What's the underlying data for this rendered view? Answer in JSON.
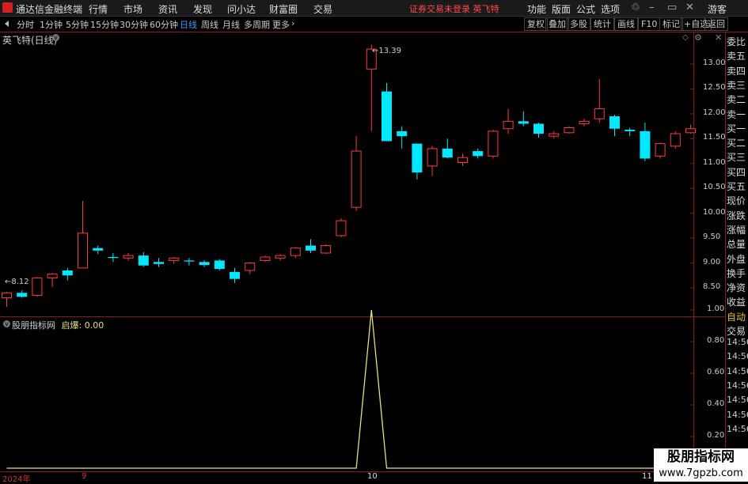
{
  "titlebar": {
    "app_name": "通达信金融终端",
    "menus": [
      "行情",
      "市场",
      "资讯",
      "发现",
      "问小达",
      "财富圈",
      "交易"
    ],
    "notice": "证券交易未登录  英飞特",
    "right_menus": [
      "功能",
      "版面",
      "公式",
      "选项"
    ],
    "guest": "游客"
  },
  "toolbar": {
    "periods": [
      "分时",
      "1分钟",
      "5分钟",
      "15分钟",
      "30分钟",
      "60分钟",
      "日线",
      "周线",
      "月线",
      "多周期",
      "更多"
    ],
    "active_period": "日线",
    "buttons": [
      "复权",
      "叠加",
      "多股",
      "统计",
      "画线",
      "F10",
      "标记",
      "+自选",
      "返回"
    ]
  },
  "main_chart": {
    "title": "英飞特(日线)",
    "max_label": "13.39",
    "min_label": "8.12",
    "y_ticks": [
      "13.00",
      "12.50",
      "12.00",
      "11.50",
      "11.00",
      "10.50",
      "10.00",
      "9.50",
      "9.00",
      "8.50"
    ],
    "candles": [
      {
        "o": 8.3,
        "c": 8.4,
        "h": 8.42,
        "l": 8.12
      },
      {
        "o": 8.4,
        "c": 8.32,
        "h": 8.45,
        "l": 8.3
      },
      {
        "o": 8.35,
        "c": 8.7,
        "h": 8.72,
        "l": 8.32
      },
      {
        "o": 8.7,
        "c": 8.78,
        "h": 8.8,
        "l": 8.52
      },
      {
        "o": 8.85,
        "c": 8.75,
        "h": 8.9,
        "l": 8.65
      },
      {
        "o": 8.9,
        "c": 9.6,
        "h": 10.25,
        "l": 8.9
      },
      {
        "o": 9.3,
        "c": 9.25,
        "h": 9.35,
        "l": 9.18
      },
      {
        "o": 9.12,
        "c": 9.1,
        "h": 9.2,
        "l": 9.02
      },
      {
        "o": 9.1,
        "c": 9.15,
        "h": 9.2,
        "l": 9.05
      },
      {
        "o": 9.15,
        "c": 8.95,
        "h": 9.22,
        "l": 8.92
      },
      {
        "o": 9.02,
        "c": 8.98,
        "h": 9.1,
        "l": 8.92
      },
      {
        "o": 9.05,
        "c": 9.1,
        "h": 9.12,
        "l": 8.98
      },
      {
        "o": 9.05,
        "c": 9.03,
        "h": 9.1,
        "l": 8.95
      },
      {
        "o": 9.02,
        "c": 8.96,
        "h": 9.06,
        "l": 8.92
      },
      {
        "o": 9.05,
        "c": 8.88,
        "h": 9.08,
        "l": 8.85
      },
      {
        "o": 8.82,
        "c": 8.68,
        "h": 8.9,
        "l": 8.6
      },
      {
        "o": 8.85,
        "c": 9.0,
        "h": 9.02,
        "l": 8.78
      },
      {
        "o": 9.05,
        "c": 9.12,
        "h": 9.15,
        "l": 9.02
      },
      {
        "o": 9.1,
        "c": 9.15,
        "h": 9.18,
        "l": 9.05
      },
      {
        "o": 9.15,
        "c": 9.3,
        "h": 9.32,
        "l": 9.1
      },
      {
        "o": 9.35,
        "c": 9.25,
        "h": 9.48,
        "l": 9.2
      },
      {
        "o": 9.2,
        "c": 9.35,
        "h": 9.38,
        "l": 9.18
      },
      {
        "o": 9.55,
        "c": 9.85,
        "h": 9.9,
        "l": 9.52
      },
      {
        "o": 10.12,
        "c": 11.25,
        "h": 11.55,
        "l": 10.05
      },
      {
        "o": 12.9,
        "c": 13.3,
        "h": 13.39,
        "l": 11.65
      },
      {
        "o": 12.45,
        "c": 11.45,
        "h": 12.62,
        "l": 11.45
      },
      {
        "o": 11.65,
        "c": 11.55,
        "h": 11.75,
        "l": 11.3
      },
      {
        "o": 11.4,
        "c": 10.82,
        "h": 11.4,
        "l": 10.68
      },
      {
        "o": 10.95,
        "c": 11.3,
        "h": 11.35,
        "l": 10.75
      },
      {
        "o": 11.3,
        "c": 11.12,
        "h": 11.5,
        "l": 11.1
      },
      {
        "o": 11.02,
        "c": 11.12,
        "h": 11.2,
        "l": 10.95
      },
      {
        "o": 11.25,
        "c": 11.15,
        "h": 11.3,
        "l": 11.1
      },
      {
        "o": 11.15,
        "c": 11.65,
        "h": 11.68,
        "l": 11.1
      },
      {
        "o": 11.7,
        "c": 11.85,
        "h": 12.1,
        "l": 11.6
      },
      {
        "o": 11.85,
        "c": 11.8,
        "h": 12.05,
        "l": 11.75
      },
      {
        "o": 11.8,
        "c": 11.6,
        "h": 11.82,
        "l": 11.52
      },
      {
        "o": 11.55,
        "c": 11.6,
        "h": 11.65,
        "l": 11.5
      },
      {
        "o": 11.62,
        "c": 11.72,
        "h": 11.75,
        "l": 11.6
      },
      {
        "o": 11.8,
        "c": 11.85,
        "h": 11.9,
        "l": 11.75
      },
      {
        "o": 11.9,
        "c": 12.1,
        "h": 12.7,
        "l": 11.82
      },
      {
        "o": 11.95,
        "c": 11.7,
        "h": 11.98,
        "l": 11.55
      },
      {
        "o": 11.68,
        "c": 11.65,
        "h": 11.72,
        "l": 11.55
      },
      {
        "o": 11.65,
        "c": 11.1,
        "h": 11.82,
        "l": 11.05
      },
      {
        "o": 11.15,
        "c": 11.4,
        "h": 11.42,
        "l": 11.1
      },
      {
        "o": 11.35,
        "c": 11.6,
        "h": 11.65,
        "l": 11.3
      },
      {
        "o": 11.62,
        "c": 11.7,
        "h": 11.78,
        "l": 11.6
      }
    ]
  },
  "indicator": {
    "name": "股朋指标网",
    "signal_label": "启爆:",
    "signal_value": "0.00",
    "y_ticks": [
      "1.00",
      "0.80",
      "0.60",
      "0.40",
      "0.20"
    ],
    "values": [
      0,
      0,
      0,
      0,
      0,
      0,
      0,
      0,
      0,
      0,
      0,
      0,
      0,
      0,
      0,
      0,
      0,
      0,
      0,
      0,
      0,
      0,
      0,
      0,
      1,
      0,
      0,
      0,
      0,
      0,
      0,
      0,
      0,
      0,
      0,
      0,
      0,
      0,
      0,
      0,
      0,
      0,
      0,
      0,
      0,
      0
    ]
  },
  "x_axis": {
    "labels": [
      "2024年",
      "9",
      "10",
      "11"
    ]
  },
  "side_panel": {
    "items": [
      "委比",
      "卖五",
      "卖四",
      "卖三",
      "卖二",
      "卖一",
      "买一",
      "买二",
      "买三",
      "买四",
      "买五",
      "现价",
      "涨跌",
      "涨幅",
      "总量",
      "外盘",
      "换手",
      "净资",
      "收益",
      "自动",
      "交易"
    ],
    "times": [
      "14:56",
      "14:56",
      "14:56",
      "14:56",
      "14:56",
      "14:56",
      "14:56"
    ]
  },
  "watermark": {
    "name": "股朋指标网",
    "url": "www.7gpzb.com"
  },
  "colors": {
    "up": "#ff3a3a",
    "down": "#00e8ff",
    "frame": "#8a1a1a",
    "indicator": "#e8e080"
  }
}
